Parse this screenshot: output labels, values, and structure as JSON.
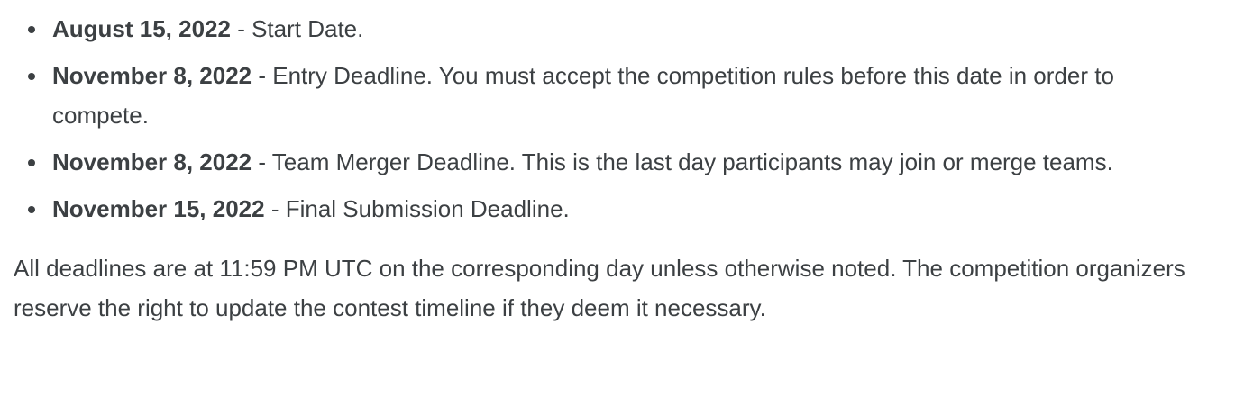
{
  "timeline": [
    {
      "date": "August 15, 2022",
      "separator": " - ",
      "description": "Start Date."
    },
    {
      "date": "November 8, 2022",
      "separator": " - ",
      "description": "Entry Deadline. You must accept the competition rules before this date in order to compete."
    },
    {
      "date": "November 8, 2022",
      "separator": " - ",
      "description": "Team Merger Deadline. This is the last day participants may join or merge teams."
    },
    {
      "date": "November 15, 2022",
      "separator": " - ",
      "description": "Final Submission Deadline."
    }
  ],
  "note": "All deadlines are at 11:59 PM UTC on the corresponding day unless otherwise noted. The competition organizers reserve the right to update the contest timeline if they deem it necessary."
}
